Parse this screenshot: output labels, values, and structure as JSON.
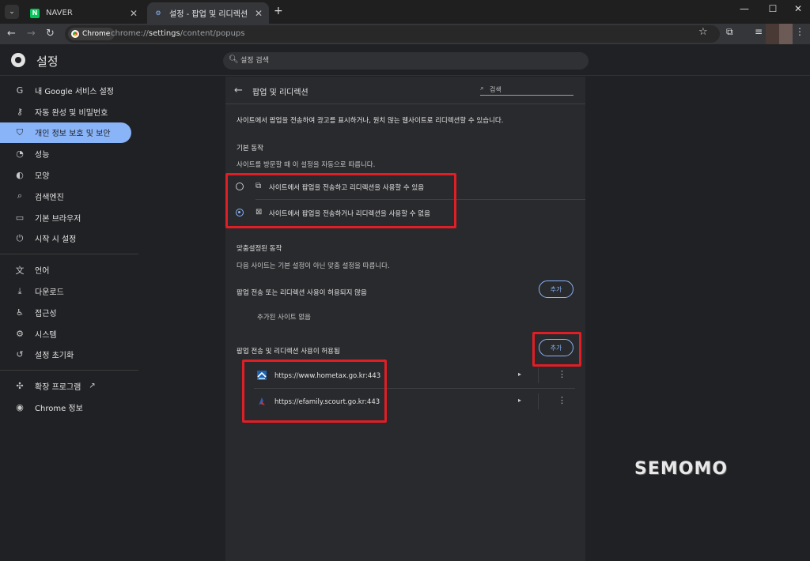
{
  "tabs": [
    {
      "title": "NAVER",
      "favicon": "naver-icon",
      "active": false
    },
    {
      "title": "설정 - 팝업 및 리디렉션",
      "favicon": "gear-icon",
      "active": true
    }
  ],
  "omnibox": {
    "chip": "Chrome",
    "url_prefix": "chrome://",
    "url_bold": "settings",
    "url_rest": "/content/popups"
  },
  "header": {
    "title": "설정",
    "search_placeholder": "설정 검색"
  },
  "sidebar": {
    "items": [
      {
        "label": "내 Google 서비스 설정",
        "icon": "google-icon"
      },
      {
        "label": "자동 완성 및 비밀번호",
        "icon": "key-icon"
      },
      {
        "label": "개인 정보 보호 및 보안",
        "icon": "shield-icon",
        "active": true
      },
      {
        "label": "성능",
        "icon": "speedometer-icon"
      },
      {
        "label": "모양",
        "icon": "palette-icon"
      },
      {
        "label": "검색엔진",
        "icon": "search-icon"
      },
      {
        "label": "기본 브라우저",
        "icon": "browser-icon"
      },
      {
        "label": "시작 시 설정",
        "icon": "power-icon"
      }
    ],
    "items2": [
      {
        "label": "언어",
        "icon": "translate-icon"
      },
      {
        "label": "다운로드",
        "icon": "download-icon"
      },
      {
        "label": "접근성",
        "icon": "accessibility-icon"
      },
      {
        "label": "시스템",
        "icon": "wrench-icon"
      },
      {
        "label": "설정 초기화",
        "icon": "reset-icon"
      }
    ],
    "items3": [
      {
        "label": "확장 프로그램",
        "icon": "puzzle-icon"
      },
      {
        "label": "Chrome 정보",
        "icon": "chrome-icon"
      }
    ]
  },
  "content": {
    "title": "팝업 및 리디렉션",
    "search_placeholder": "검색",
    "description": "사이트에서 팝업을 전송하여 광고를 표시하거나, 원치 않는 웹사이트로 리디렉션할 수 있습니다.",
    "default_heading": "기본 동작",
    "default_sub": "사이트를 방문할 때 이 설정을 자동으로 따릅니다.",
    "option_allow": "사이트에서 팝업을 전송하고 리디렉션을 사용할 수 있음",
    "option_block": "사이트에서 팝업을 전송하거나 리디렉션을 사용할 수 없음",
    "selected_option": "block",
    "custom_heading": "맞춤설정된 동작",
    "custom_sub": "다음 사이트는 기본 설정이 아닌 맞춤 설정을 따릅니다.",
    "blocked_heading": "팝업 전송 또는 리디렉션 사용이 허용되지 않음",
    "blocked_empty": "추가된 사이트 없음",
    "allowed_heading": "팝업 전송 및 리디렉션 사용이 허용됨",
    "add_label": "추가",
    "allowed_sites": [
      "https://www.hometax.go.kr:443",
      "https://efamily.scourt.go.kr:443"
    ]
  },
  "watermark": "SEMOMO",
  "colors": {
    "accent": "#8ab4f8",
    "highlight": "#e01e26"
  }
}
